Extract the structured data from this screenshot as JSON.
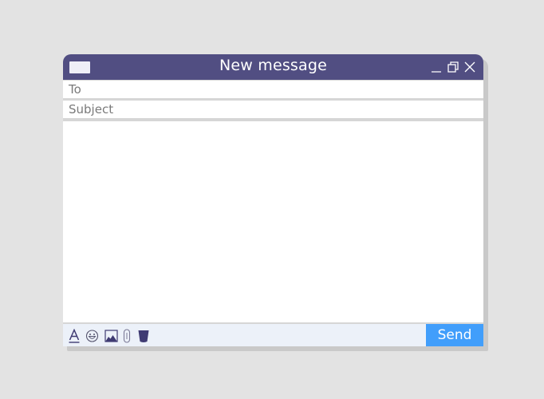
{
  "window": {
    "title": "New message",
    "controls": [
      {
        "name": "minimize",
        "icon": "minimize-icon"
      },
      {
        "name": "restore",
        "icon": "restore-icon"
      },
      {
        "name": "close",
        "icon": "close-icon"
      }
    ]
  },
  "fields": {
    "to": {
      "placeholder": "To",
      "value": ""
    },
    "subject": {
      "placeholder": "Subject",
      "value": ""
    }
  },
  "body": {
    "value": ""
  },
  "toolbar": {
    "icons": [
      "text-format-icon",
      "emoji-icon",
      "image-icon",
      "attachment-icon",
      "trash-icon"
    ],
    "send_label": "Send"
  },
  "colors": {
    "titlebar": "#514e82",
    "send": "#419efb",
    "toolbar": "#ecf1f9",
    "icon": "#3f3b73"
  }
}
